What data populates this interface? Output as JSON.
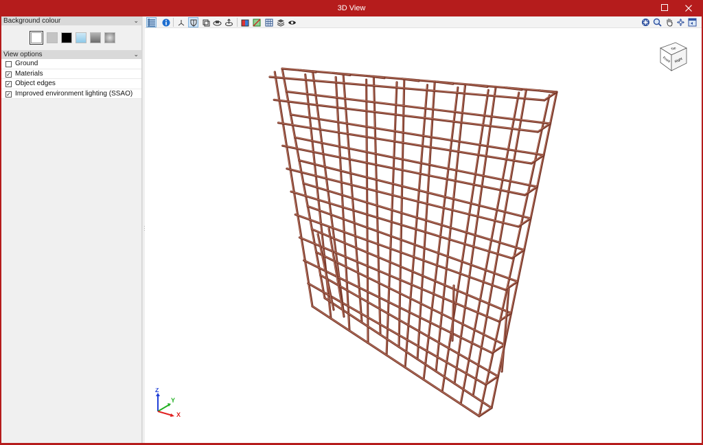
{
  "window": {
    "title": "3D View",
    "maximize_icon": "maximize-icon",
    "close_icon": "close-icon"
  },
  "left_panel": {
    "background_section": {
      "title": "Background colour",
      "swatches": [
        {
          "name": "white",
          "color": "#ffffff",
          "selected": true
        },
        {
          "name": "light-grey",
          "color": "#c4c4c4"
        },
        {
          "name": "black",
          "color": "#000000"
        },
        {
          "name": "light-blue-gradient",
          "color": "#a9d6ee"
        },
        {
          "name": "grey-gradient",
          "color": "#8c8c8c"
        },
        {
          "name": "radial-grey",
          "color": "#9a9a9a"
        }
      ]
    },
    "view_options": {
      "title": "View options",
      "items": [
        {
          "label": "Ground",
          "checked": false
        },
        {
          "label": "Materials",
          "checked": true
        },
        {
          "label": "Object edges",
          "checked": true
        },
        {
          "label": "Improved environment lighting (SSAO)",
          "checked": true
        }
      ]
    }
  },
  "toolbar": {
    "left_tools": [
      "layers-icon",
      "info-icon",
      "axis-view-icon",
      "shield-view-icon",
      "perspective-icon",
      "orbit-icon",
      "rotate-icon",
      "section-box-icon",
      "clip-plane-icon",
      "grid-icon",
      "layers-stack-icon",
      "visibility-eye-icon"
    ],
    "right_tools": [
      "zoom-extents-icon",
      "zoom-icon",
      "pan-hand-icon",
      "orbit-move-icon",
      "view-window-icon"
    ]
  },
  "view_cube": {
    "top": "Top",
    "front": "Front",
    "right": "Right"
  },
  "axes": {
    "x": "X",
    "y": "Y",
    "z": "Z"
  },
  "colors": {
    "titlebar": "#b51c1c",
    "rebar": "#7a3a2c",
    "rebar_highlight": "#c7826c",
    "axis_x": "#e02020",
    "axis_y": "#22b022",
    "axis_z": "#1f3fd6"
  }
}
